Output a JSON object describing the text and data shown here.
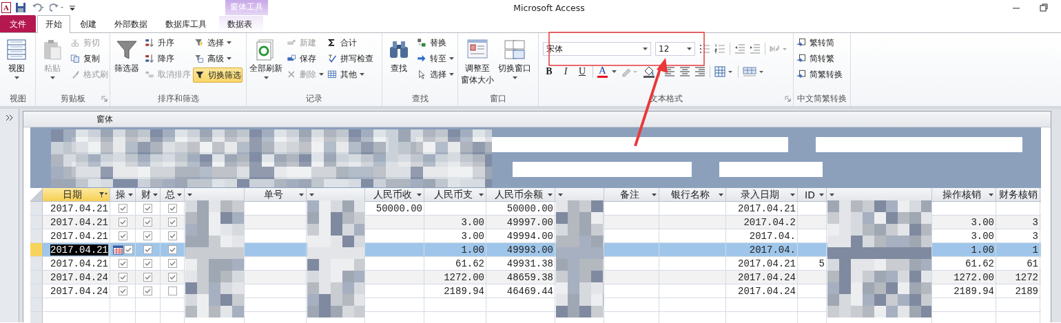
{
  "window": {
    "title": "Microsoft Access",
    "app_icon_letter": "A"
  },
  "context_tab_header": "窗体工具",
  "tabs": [
    {
      "label": "文件",
      "kind": "file",
      "selected": false
    },
    {
      "label": "开始",
      "kind": "tab",
      "selected": true
    },
    {
      "label": "创建",
      "kind": "tab",
      "selected": false
    },
    {
      "label": "外部数据",
      "kind": "tab",
      "selected": false
    },
    {
      "label": "数据库工具",
      "kind": "tab",
      "selected": false
    },
    {
      "label": "数据表",
      "kind": "context",
      "selected": false
    }
  ],
  "ribbon_groups": [
    {
      "label": "视图",
      "columns": [
        {
          "kind": "large",
          "items": [
            {
              "label": "视图",
              "disabled": false,
              "dropdown": true
            }
          ]
        }
      ]
    },
    {
      "label": "剪贴板",
      "launcher": true,
      "columns": [
        {
          "kind": "large",
          "items": [
            {
              "label": "粘贴",
              "disabled": true,
              "dropdown": true
            }
          ]
        },
        {
          "kind": "small",
          "items": [
            {
              "label": "剪切",
              "disabled": true,
              "dropdown": false
            },
            {
              "label": "复制",
              "disabled": false,
              "dropdown": false
            },
            {
              "label": "格式刷",
              "disabled": true,
              "dropdown": false
            }
          ]
        }
      ]
    },
    {
      "label": "排序和筛选",
      "columns": [
        {
          "kind": "large",
          "items": [
            {
              "label": "筛选器",
              "disabled": false,
              "dropdown": false
            }
          ]
        },
        {
          "kind": "small",
          "items": [
            {
              "label": "升序",
              "disabled": false,
              "dropdown": false
            },
            {
              "label": "降序",
              "disabled": false,
              "dropdown": false
            },
            {
              "label": "取消排序",
              "disabled": true,
              "dropdown": false
            }
          ]
        },
        {
          "kind": "small",
          "items": [
            {
              "label": "选择",
              "disabled": false,
              "dropdown": true
            },
            {
              "label": "高级",
              "disabled": false,
              "dropdown": true
            },
            {
              "label": "切换筛选",
              "disabled": false,
              "dropdown": false,
              "selected": true
            }
          ]
        }
      ]
    },
    {
      "label": "记录",
      "columns": [
        {
          "kind": "large",
          "items": [
            {
              "label": "全部刷新",
              "disabled": false,
              "dropdown": true
            }
          ]
        },
        {
          "kind": "small",
          "items": [
            {
              "label": "新建",
              "disabled": true,
              "dropdown": false
            },
            {
              "label": "保存",
              "disabled": false,
              "dropdown": false
            },
            {
              "label": "删除",
              "disabled": true,
              "dropdown": true
            }
          ]
        },
        {
          "kind": "small",
          "items": [
            {
              "label": "合计",
              "disabled": false,
              "dropdown": false
            },
            {
              "label": "拼写检查",
              "disabled": false,
              "dropdown": false
            },
            {
              "label": "其他",
              "disabled": false,
              "dropdown": true
            }
          ]
        }
      ]
    },
    {
      "label": "查找",
      "columns": [
        {
          "kind": "large",
          "items": [
            {
              "label": "查找",
              "disabled": false,
              "dropdown": false
            }
          ]
        },
        {
          "kind": "small",
          "items": [
            {
              "label": "替换",
              "disabled": false,
              "dropdown": false
            },
            {
              "label": "转至",
              "disabled": false,
              "dropdown": true
            },
            {
              "label": "选择",
              "disabled": false,
              "dropdown": true
            }
          ]
        }
      ]
    },
    {
      "label": "窗口",
      "columns": [
        {
          "kind": "large",
          "items": [
            {
              "lines": [
                "调整至",
                "窗体大小"
              ],
              "disabled": false,
              "dropdown": false
            }
          ]
        },
        {
          "kind": "large",
          "items": [
            {
              "label": "切换窗口",
              "disabled": false,
              "dropdown": true
            }
          ]
        }
      ]
    },
    {
      "label": "文本格式",
      "launcher": true,
      "columns": [
        {
          "kind": "format",
          "font": "宋体",
          "size": "12",
          "style_buttons": [
            "B",
            "I",
            "U"
          ],
          "font_color_glyph": "A"
        }
      ]
    },
    {
      "label": "中文简繁转换",
      "columns": [
        {
          "kind": "small",
          "items": [
            {
              "label": "繁转简",
              "disabled": false,
              "dropdown": false
            },
            {
              "label": "简转繁",
              "disabled": false,
              "dropdown": false
            },
            {
              "label": "简繁转换",
              "disabled": false,
              "dropdown": false
            }
          ]
        }
      ]
    }
  ],
  "form": {
    "tab_label": "窗体"
  },
  "table": {
    "columns": [
      {
        "label": "日期",
        "kind": "date",
        "filtered": true
      },
      {
        "label": "操",
        "kind": "check"
      },
      {
        "label": "财",
        "kind": "check"
      },
      {
        "label": "总",
        "kind": "check"
      },
      {
        "kind": "redacted"
      },
      {
        "label": "单号",
        "kind": "text"
      },
      {
        "kind": "redacted"
      },
      {
        "label": "人民币收",
        "kind": "number"
      },
      {
        "label": "人民币支",
        "kind": "number"
      },
      {
        "label": "人民币余额",
        "kind": "number"
      },
      {
        "kind": "redacted"
      },
      {
        "label": "备注",
        "kind": "text"
      },
      {
        "label": "银行名称",
        "kind": "text"
      },
      {
        "label": "录入日期",
        "kind": "date"
      },
      {
        "label": "ID",
        "kind": "number"
      },
      {
        "kind": "redacted"
      },
      {
        "label": "操作核销",
        "kind": "number"
      },
      {
        "label": "财务核销",
        "kind": "number"
      }
    ],
    "rows": [
      {
        "selected": false,
        "cells": [
          "2017.04.21",
          true,
          true,
          true,
          null,
          null,
          null,
          "50000.00",
          null,
          "50000.00",
          null,
          null,
          null,
          "2017.04.21",
          null,
          null,
          null,
          null
        ]
      },
      {
        "selected": false,
        "cells": [
          "2017.04.21",
          true,
          true,
          true,
          null,
          null,
          null,
          null,
          "3.00",
          "49997.00",
          null,
          null,
          null,
          "2017.04.2",
          null,
          null,
          "3.00",
          "3"
        ]
      },
      {
        "selected": false,
        "cells": [
          "2017.04.21",
          true,
          true,
          true,
          null,
          null,
          null,
          null,
          "3.00",
          "49994.00",
          null,
          null,
          null,
          "2017.04.",
          null,
          null,
          "3.00",
          "3"
        ]
      },
      {
        "selected": true,
        "cells": [
          "2017.04.21",
          true,
          true,
          true,
          null,
          null,
          null,
          null,
          "1.00",
          "49993.00",
          null,
          null,
          null,
          "2017.04.",
          null,
          null,
          "1.00",
          "1"
        ]
      },
      {
        "selected": false,
        "cells": [
          "2017.04.21",
          true,
          true,
          true,
          null,
          null,
          null,
          null,
          "61.62",
          "49931.38",
          null,
          null,
          null,
          "2017.04.21",
          "5",
          null,
          "61.62",
          "61"
        ]
      },
      {
        "selected": false,
        "cells": [
          "2017.04.24",
          true,
          true,
          true,
          null,
          null,
          null,
          null,
          "1272.00",
          "48659.38",
          null,
          null,
          null,
          "2017.04.24",
          null,
          null,
          "1272.00",
          "1272"
        ]
      },
      {
        "selected": false,
        "cells": [
          "2017.04.24",
          true,
          true,
          false,
          null,
          null,
          null,
          null,
          "2189.94",
          "46469.44",
          null,
          null,
          null,
          "2017.04.24",
          null,
          null,
          "2189.94",
          "2189"
        ]
      }
    ]
  }
}
